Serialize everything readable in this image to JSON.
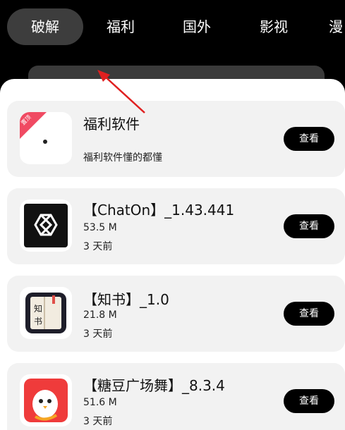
{
  "tabs": [
    {
      "label": "破解"
    },
    {
      "label": "福利"
    },
    {
      "label": "国外"
    },
    {
      "label": "影视"
    },
    {
      "label": "漫"
    }
  ],
  "apps": [
    {
      "title": "福利软件",
      "sub1": "福利软件懂的都懂",
      "badge": "置顶",
      "button": "查看",
      "icon": "blank-app-icon"
    },
    {
      "title": "【ChatOn】_1.43.441",
      "sub1": "53.5 M",
      "sub2": "3 天前",
      "button": "查看",
      "icon": "chaton-logo-icon"
    },
    {
      "title": "【知书】_1.0",
      "sub1": "21.8 M",
      "sub2": "3 天前",
      "button": "查看",
      "icon": "zhishu-book-icon",
      "icon_text": "知书"
    },
    {
      "title": "【糖豆广场舞】_8.3.4",
      "sub1": "51.6 M",
      "sub2": "3 天前",
      "button": "查看",
      "icon": "tangdou-bird-icon"
    }
  ],
  "colors": {
    "accent": "#000000",
    "badge": "#f04a62",
    "card": "#f2f2f2",
    "annotation": "#e02020"
  }
}
